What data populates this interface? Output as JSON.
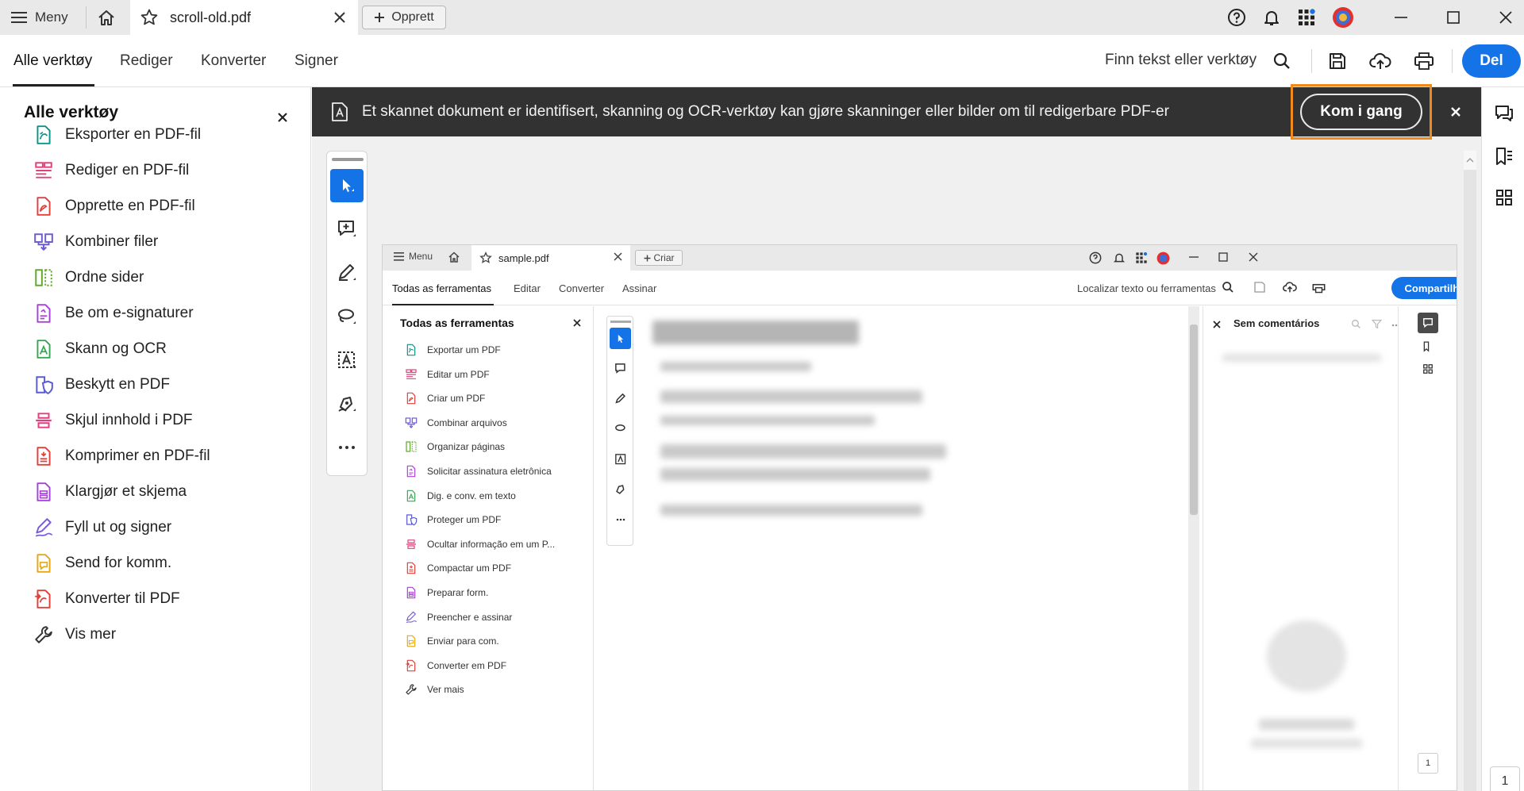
{
  "titlebar": {
    "menu_label": "Meny",
    "tab_title": "scroll-old.pdf",
    "create_label": "Opprett"
  },
  "menubar": {
    "items": [
      "Alle verktøy",
      "Rediger",
      "Konverter",
      "Signer"
    ],
    "find_label": "Finn tekst eller verktøy",
    "share_label": "Del"
  },
  "tools_panel": {
    "title": "Alle verktøy",
    "items": [
      {
        "label": "Eksporter en PDF-fil",
        "icon": "export-pdf-icon",
        "color": "#0d9488"
      },
      {
        "label": "Rediger en PDF-fil",
        "icon": "edit-pdf-icon",
        "color": "#e0407b"
      },
      {
        "label": "Opprette en PDF-fil",
        "icon": "create-pdf-icon",
        "color": "#e0413b"
      },
      {
        "label": "Kombiner filer",
        "icon": "combine-files-icon",
        "color": "#6d5bd0"
      },
      {
        "label": "Ordne sider",
        "icon": "organize-pages-icon",
        "color": "#5fa82a"
      },
      {
        "label": "Be om e-signaturer",
        "icon": "request-signature-icon",
        "color": "#a544d6"
      },
      {
        "label": "Skann og OCR",
        "icon": "scan-ocr-icon",
        "color": "#3aa655"
      },
      {
        "label": "Beskytt en PDF",
        "icon": "protect-pdf-icon",
        "color": "#5a5ad6"
      },
      {
        "label": "Skjul innhold i PDF",
        "icon": "redact-icon",
        "color": "#e0407b"
      },
      {
        "label": "Komprimer en PDF-fil",
        "icon": "compress-pdf-icon",
        "color": "#e0413b"
      },
      {
        "label": "Klargjør et skjema",
        "icon": "prepare-form-icon",
        "color": "#a544d6"
      },
      {
        "label": "Fyll ut og signer",
        "icon": "fill-sign-icon",
        "color": "#7b5cd6"
      },
      {
        "label": "Send for komm.",
        "icon": "send-comment-icon",
        "color": "#e6a817"
      },
      {
        "label": "Konverter til PDF",
        "icon": "convert-pdf-icon",
        "color": "#e0413b"
      },
      {
        "label": "Vis mer",
        "icon": "wrench-icon",
        "color": "#333333"
      }
    ]
  },
  "banner": {
    "text": "Et skannet dokument er identifisert, skanning og OCR-verktøy kan gjøre skanninger eller bilder om til redigerbare PDF-er",
    "button_label": "Kom i gang"
  },
  "page_number": "1",
  "nested": {
    "menu_label": "Menu",
    "tab_title": "sample.pdf",
    "create_label": "Criar",
    "menubar_items": [
      "Todas as ferramentas",
      "Editar",
      "Converter",
      "Assinar"
    ],
    "find_label": "Localizar texto ou ferramentas",
    "share_label": "Compartilhar",
    "tools_title": "Todas as ferramentas",
    "tools": [
      "Exportar um PDF",
      "Editar um PDF",
      "Criar um PDF",
      "Combinar arquivos",
      "Organizar páginas",
      "Solicitar assinatura eletrônica",
      "Dig. e conv. em texto",
      "Proteger um PDF",
      "Ocultar informação em um P...",
      "Compactar um PDF",
      "Preparar form.",
      "Preencher e assinar",
      "Enviar para com.",
      "Converter em PDF",
      "Ver mais"
    ],
    "comments_title": "Sem comentários",
    "page_number": "1"
  },
  "colors": {
    "accent": "#1473e6",
    "banner_bg": "#323232",
    "highlight": "#f08a1c"
  }
}
